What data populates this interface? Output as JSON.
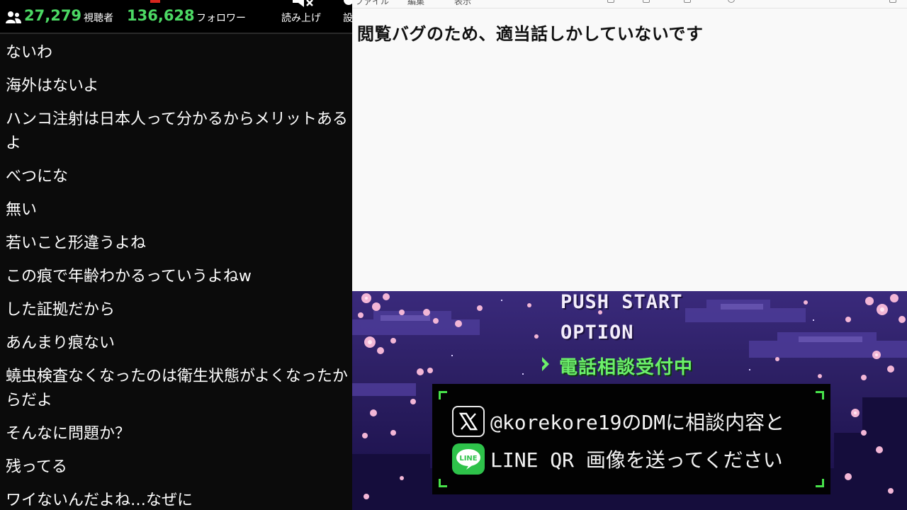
{
  "chat": {
    "viewers": "27,279",
    "viewers_label": "視聴者",
    "followers": "136,628",
    "followers_label": "フォロワー",
    "tools": [
      {
        "label": "読み上げ",
        "icon": "speaker-mute-icon"
      },
      {
        "label": "設",
        "icon": "gear-icon"
      }
    ],
    "accent": "#4cd964",
    "messages": [
      "ないわ",
      "海外はないよ",
      "ハンコ注射は日本人って分かるからメリットあるよ",
      "べつにな",
      "無い",
      "若いこと形違うよね",
      "この痕で年齢わかるっていうよねw",
      "した証拠だから",
      "あんまり痕ない",
      "蟯虫検査なくなったのは衛生状態がよくなったからだよ",
      "そんなに問題か？",
      "残ってる",
      "ワイないんだよね…なぜに"
    ]
  },
  "notepad": {
    "menu": [
      "ファイル",
      "編集",
      "表示"
    ],
    "text": "閲覧バグのため、適当話しかしていないです"
  },
  "scene": {
    "menu": {
      "push_start": "PUSH START",
      "option": "OPTION",
      "phone_consult": "電話相談受付中"
    },
    "dialog": {
      "line1": "@korekore19のDMに相談内容と",
      "line2": "LINE QR 画像を送ってください",
      "line2_logo_text": "LINE"
    },
    "colors": {
      "sky": "#2c1f63",
      "highlight_green": "#6cf06a",
      "frame_green": "#47e24a",
      "sakura_pink": "#f2b6d6"
    }
  }
}
